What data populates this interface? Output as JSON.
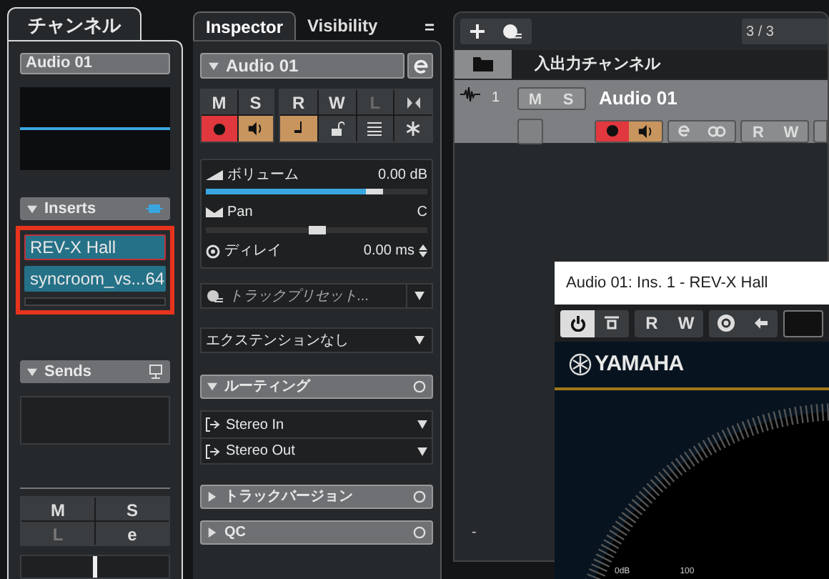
{
  "channel_panel": {
    "tab": "チャンネル",
    "track_name": "Audio 01",
    "inserts": {
      "title": "Inserts",
      "slots": [
        {
          "name": "REV-X Hall",
          "selected": true
        },
        {
          "name": "syncroom_vs...64",
          "selected": false
        }
      ]
    },
    "sends": {
      "title": "Sends"
    },
    "buttons": [
      {
        "label": "M",
        "disabled": false
      },
      {
        "label": "S",
        "disabled": false
      },
      {
        "label": "L",
        "disabled": true
      },
      {
        "label": "e",
        "disabled": false
      }
    ]
  },
  "inspector": {
    "tabs": [
      {
        "label": "Inspector",
        "selected": true
      },
      {
        "label": "Visibility",
        "selected": false
      }
    ],
    "menu": "=",
    "track_name": "Audio 01",
    "top_buttons": [
      {
        "label": "M",
        "disabled": false
      },
      {
        "label": "S",
        "disabled": false
      },
      {
        "label": "R",
        "disabled": false
      },
      {
        "label": "W",
        "disabled": false
      },
      {
        "label": "L",
        "disabled": true
      }
    ],
    "state_buttons": [
      {
        "kind": "record",
        "on": true
      },
      {
        "kind": "monitor",
        "on": true
      },
      {
        "kind": "timebase",
        "on": true
      },
      {
        "kind": "lock",
        "on": false
      },
      {
        "kind": "lanes",
        "on": false
      },
      {
        "kind": "freeze",
        "on": false
      }
    ],
    "volume": {
      "label": "ボリューム",
      "value": "0.00 dB",
      "level": 0.8
    },
    "pan": {
      "label": "Pan",
      "value": "C",
      "level": 0.5
    },
    "delay": {
      "label": "ディレイ",
      "value": "0.00 ms"
    },
    "track_preset": {
      "placeholder": "トラックプリセット..."
    },
    "extension": "エクステンションなし",
    "sections": [
      {
        "title": "ルーティング",
        "expanded": true,
        "items": [
          "Stereo In",
          "Stereo Out"
        ]
      },
      {
        "title": "トラックバージョン",
        "expanded": false
      },
      {
        "title": "QC",
        "expanded": false
      }
    ]
  },
  "project": {
    "counter": "3 / 3",
    "folder": "入出力チャンネル",
    "track": {
      "number": "1",
      "name": "Audio 01",
      "record": true,
      "monitor": true
    },
    "buttons": [
      "M",
      "S",
      "R",
      "W"
    ],
    "marker": "-"
  },
  "plugin_window": {
    "title": "Audio 01: Ins. 1 - REV-X Hall",
    "buttons": [
      "R",
      "W"
    ],
    "logo": "YAMAHA",
    "dial_labels": [
      "0dB",
      "100"
    ]
  }
}
